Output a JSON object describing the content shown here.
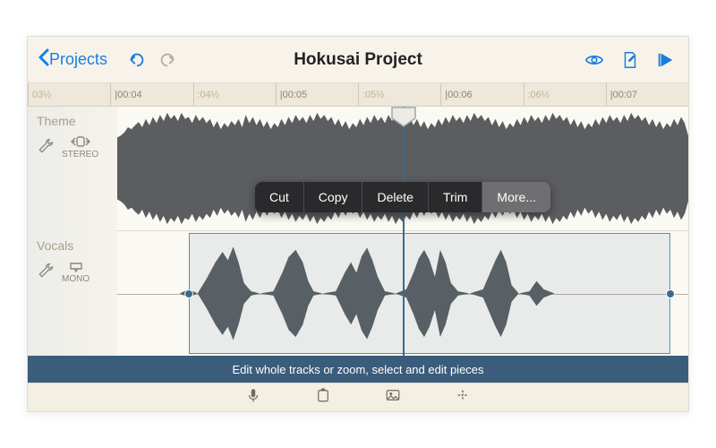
{
  "nav": {
    "back_label": "Projects",
    "title": "Hokusai Project"
  },
  "ruler": {
    "marks": [
      "03½",
      "|00:04",
      ":04½",
      "|00:05",
      ":05½",
      "|00:06",
      ":06½",
      "|00:07"
    ]
  },
  "tracks": [
    {
      "name": "Theme",
      "channel_label": "STEREO"
    },
    {
      "name": "Vocals",
      "channel_label": "MONO"
    }
  ],
  "context_menu": {
    "items": [
      "Cut",
      "Copy",
      "Delete",
      "Trim",
      "More..."
    ]
  },
  "hint": "Edit whole tracks or zoom, select and edit pieces",
  "colors": {
    "accent": "#1a7de0",
    "playhead": "#3c6a8f",
    "hintbar": "#3b5d7b"
  }
}
